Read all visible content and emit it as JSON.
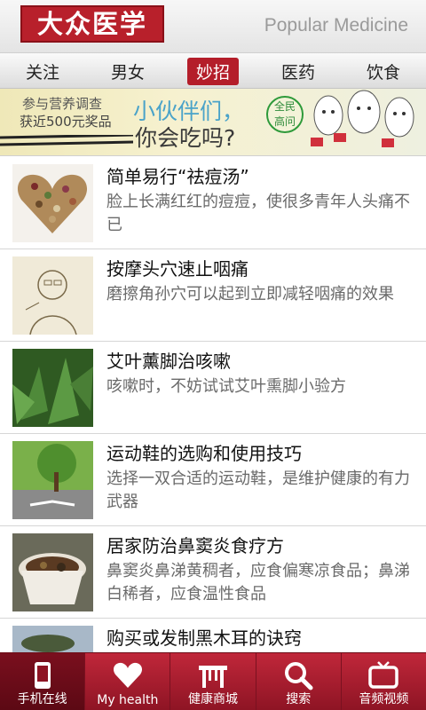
{
  "header": {
    "logo_text": "大众医学",
    "subtitle": "Popular Medicine"
  },
  "tabs": [
    {
      "label": "关注"
    },
    {
      "label": "男女"
    },
    {
      "label": "妙招",
      "active": true
    },
    {
      "label": "医药"
    },
    {
      "label": "饮食"
    }
  ],
  "banner": {
    "line1": "参与营养调查",
    "line2": "获近500元奖品",
    "headline1": "小伙伴们，",
    "headline2": "你会吃吗?",
    "badge_line1": "全民",
    "badge_line2": "高问"
  },
  "list": [
    {
      "title": "简单易行“祛痘汤”",
      "desc": "脸上长满红红的痘痘，使很多青年人头痛不已",
      "thumb": "heart-beans-image"
    },
    {
      "title": "按摩头穴速止咽痛",
      "desc": "磨擦角孙穴可以起到立即减轻咽痛的效果",
      "thumb": "sketch-portrait-image"
    },
    {
      "title": "艾叶薰脚治咳嗽",
      "desc": "咳嗽时，不妨试试艾叶熏脚小验方",
      "thumb": "mugwort-leaves-image"
    },
    {
      "title": "运动鞋的选购和使用技巧",
      "desc": "选择一双合适的运动鞋，是维护健康的有力武器",
      "thumb": "tree-road-image"
    },
    {
      "title": "居家防治鼻窦炎食疗方",
      "desc": "鼻窦炎鼻涕黄稠者，应食偏寒凉食品；鼻涕白稀者，应食温性食品",
      "thumb": "soup-bowl-image"
    },
    {
      "title": "购买或发制黑木耳的诀窍",
      "desc": "",
      "thumb": "fungus-image"
    }
  ],
  "bottom_nav": [
    {
      "label": "手机在线",
      "icon": "phone-icon",
      "active": true
    },
    {
      "label": "My health",
      "icon": "heart-icon"
    },
    {
      "label": "健康商城",
      "icon": "shop-icon"
    },
    {
      "label": "搜索",
      "icon": "search-icon"
    },
    {
      "label": "音频视频",
      "icon": "tv-icon"
    }
  ],
  "colors": {
    "brand_red": "#b41e2a",
    "nav_red": "#a81c2e"
  }
}
